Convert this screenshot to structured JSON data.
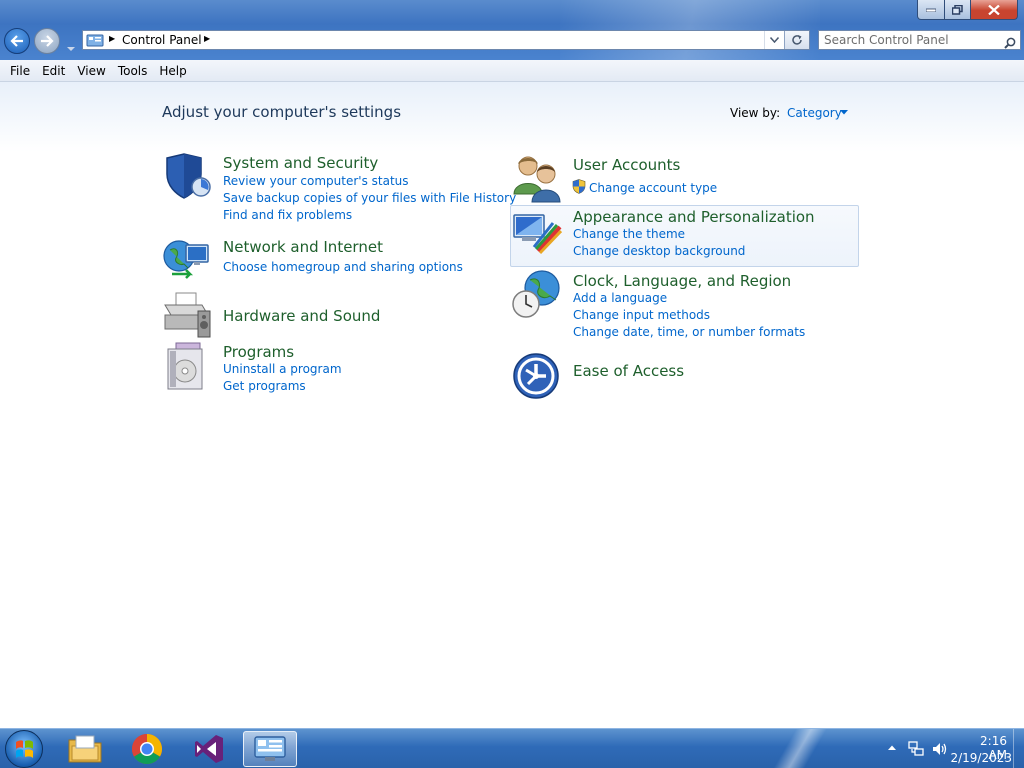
{
  "window": {
    "address": {
      "crumbs": [
        "Control Panel"
      ]
    },
    "search": {
      "placeholder": "Search Control Panel"
    }
  },
  "menu": [
    "File",
    "Edit",
    "View",
    "Tools",
    "Help"
  ],
  "main": {
    "title": "Adjust your computer's settings",
    "view_by_label": "View by:",
    "view_by_value": "Category",
    "left_categories": [
      {
        "title": "System and Security",
        "links": [
          "Review your computer's status",
          "Save backup copies of your files with File History",
          "Find and fix problems"
        ]
      },
      {
        "title": "Network and Internet",
        "links": [
          "Choose homegroup and sharing options"
        ]
      },
      {
        "title": "Hardware and Sound",
        "links": []
      },
      {
        "title": "Programs",
        "links": [
          "Uninstall a program",
          "Get programs"
        ]
      }
    ],
    "right_categories": [
      {
        "title": "User Accounts",
        "links": [
          "Change account type"
        ]
      },
      {
        "title": "Appearance and Personalization",
        "links": [
          "Change the theme",
          "Change desktop background"
        ]
      },
      {
        "title": "Clock, Language, and Region",
        "links": [
          "Add a language",
          "Change input methods",
          "Change date, time, or number formats"
        ]
      },
      {
        "title": "Ease of Access",
        "links": []
      }
    ]
  },
  "taskbar": {
    "apps": [
      "file-explorer-icon",
      "chrome-icon",
      "visual-studio-icon",
      "control-panel-icon"
    ],
    "clock": {
      "time": "2:16 AM",
      "date": "2/19/2023"
    }
  },
  "colors": {
    "title_green": "#1e5f2c",
    "link_blue": "#0066cc",
    "taskbar_blue": "#2f6bb8"
  }
}
